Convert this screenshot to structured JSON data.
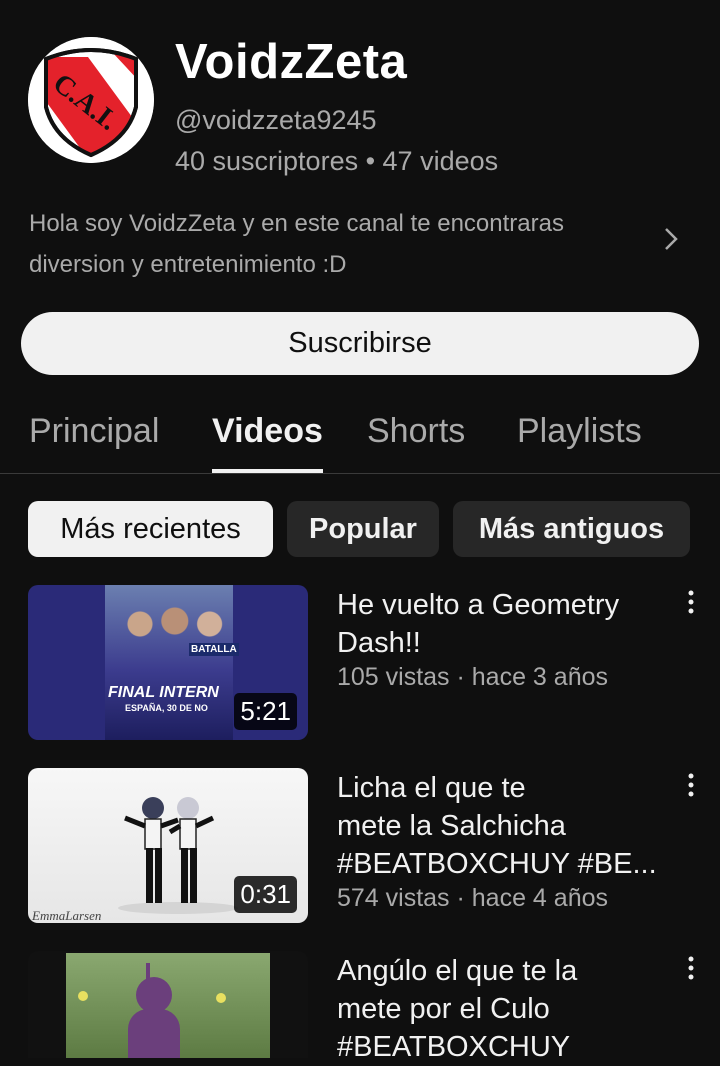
{
  "channel": {
    "name": "VoidzZeta",
    "handle": "@voidzzeta9245",
    "stats": "40 suscriptores • 47 videos",
    "description": "Hola soy VoidzZeta y en este canal te encontraras diversion y entretenimiento :D",
    "avatar_text": "C.A.I."
  },
  "subscribe_label": "Suscribirse",
  "tabs": [
    {
      "label": "Principal"
    },
    {
      "label": "Videos"
    },
    {
      "label": "Shorts"
    },
    {
      "label": "Playlists"
    }
  ],
  "chips": [
    {
      "label": "Más recientes"
    },
    {
      "label": "Popular"
    },
    {
      "label": "Más antiguos"
    }
  ],
  "videos": [
    {
      "title_lines": [
        "He vuelto a Geometry",
        "Dash!!"
      ],
      "meta": "105 vistas · hace 3 años",
      "duration": "5:21",
      "thumb_text": [
        "FINAL INTERN",
        "BATALLA",
        "ESPAÑA, 30 DE NO"
      ]
    },
    {
      "title_lines": [
        "Licha el que te",
        "mete la Salchicha",
        "#BEATBOXCHUY #BE..."
      ],
      "meta": "574 vistas · hace 4 años",
      "duration": "0:31",
      "thumb_text": [
        "EmmaLarsen"
      ]
    },
    {
      "title_lines": [
        "Angúlo el que te la",
        "mete por el Culo",
        "#BEATBOXCHUY"
      ],
      "meta": "",
      "duration": ""
    }
  ],
  "colors": {
    "background": "#0f0f0f",
    "primary_text": "#f1f1f1",
    "secondary_text": "#aaaaaa",
    "chip_bg": "#272727",
    "avatar_red": "#e4222b"
  },
  "icons": [
    "chevron-right-icon",
    "more-vert-icon"
  ]
}
